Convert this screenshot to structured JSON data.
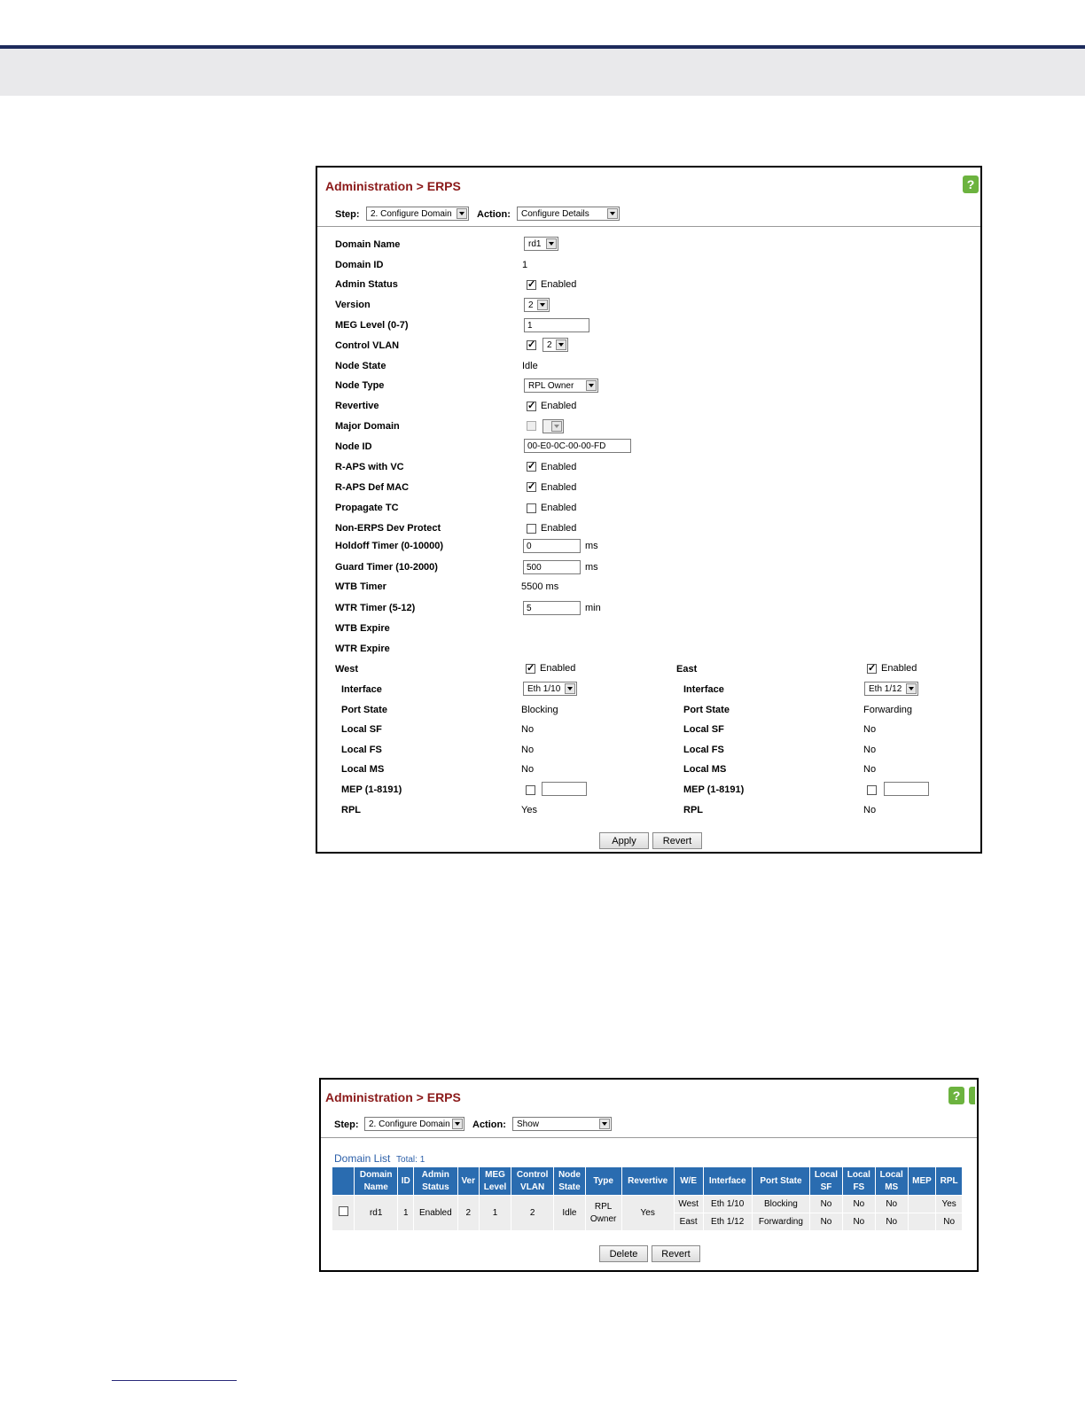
{
  "panel1": {
    "title": "Administration > ERPS",
    "step_label": "Step:",
    "step_value": "2. Configure Domain",
    "action_label": "Action:",
    "action_value": "Configure Details",
    "fields": {
      "domain_name": {
        "label": "Domain Name",
        "value": "rd1"
      },
      "domain_id": {
        "label": "Domain ID",
        "value": "1"
      },
      "admin_status": {
        "label": "Admin Status",
        "value": "Enabled"
      },
      "version": {
        "label": "Version",
        "value": "2"
      },
      "meg_level": {
        "label": "MEG Level (0-7)",
        "value": "1"
      },
      "control_vlan": {
        "label": "Control VLAN",
        "value": "2"
      },
      "node_state": {
        "label": "Node State",
        "value": "Idle"
      },
      "node_type": {
        "label": "Node Type",
        "value": "RPL Owner"
      },
      "revertive": {
        "label": "Revertive",
        "value": "Enabled"
      },
      "major_domain": {
        "label": "Major Domain",
        "value": ""
      },
      "node_id": {
        "label": "Node ID",
        "value": "00-E0-0C-00-00-FD"
      },
      "raps_vc": {
        "label": "R-APS with VC",
        "value": "Enabled"
      },
      "raps_def_mac": {
        "label": "R-APS Def MAC",
        "value": "Enabled"
      },
      "propagate_tc": {
        "label": "Propagate TC",
        "value": "Enabled"
      },
      "non_erps": {
        "label": "Non-ERPS Dev Protect",
        "value": "Enabled"
      },
      "holdoff": {
        "label": "Holdoff Timer (0-10000)",
        "value": "0",
        "unit": "ms"
      },
      "guard": {
        "label": "Guard Timer (10-2000)",
        "value": "500",
        "unit": "ms"
      },
      "wtb_timer": {
        "label": "WTB Timer",
        "value": "5500 ms"
      },
      "wtr_timer": {
        "label": "WTR Timer (5-12)",
        "value": "5",
        "unit": "min"
      },
      "wtb_expire": {
        "label": "WTB Expire"
      },
      "wtr_expire": {
        "label": "WTR Expire"
      }
    },
    "west": {
      "label": "West",
      "enabled": "Enabled",
      "interface_label": "Interface",
      "interface": "Eth 1/10",
      "port_state_label": "Port State",
      "port_state": "Blocking",
      "local_sf_label": "Local SF",
      "local_sf": "No",
      "local_fs_label": "Local FS",
      "local_fs": "No",
      "local_ms_label": "Local MS",
      "local_ms": "No",
      "mep_label": "MEP (1-8191)",
      "rpl_label": "RPL",
      "rpl": "Yes"
    },
    "east": {
      "label": "East",
      "enabled": "Enabled",
      "interface_label": "Interface",
      "interface": "Eth 1/12",
      "port_state_label": "Port State",
      "port_state": "Forwarding",
      "local_sf_label": "Local SF",
      "local_sf": "No",
      "local_fs_label": "Local FS",
      "local_fs": "No",
      "local_ms_label": "Local MS",
      "local_ms": "No",
      "mep_label": "MEP (1-8191)",
      "rpl_label": "RPL",
      "rpl": "No"
    },
    "apply": "Apply",
    "revert": "Revert"
  },
  "panel2": {
    "title": "Administration > ERPS",
    "step_label": "Step:",
    "step_value": "2. Configure Domain",
    "action_label": "Action:",
    "action_value": "Show",
    "list_title": "Domain List",
    "total": "Total: 1",
    "headers": {
      "domain_name": [
        "Domain",
        "Name"
      ],
      "id": "ID",
      "admin_status": [
        "Admin",
        "Status"
      ],
      "ver": "Ver",
      "meg_level": [
        "MEG",
        "Level"
      ],
      "control_vlan": [
        "Control",
        "VLAN"
      ],
      "node_state": [
        "Node",
        "State"
      ],
      "type": "Type",
      "revertive": "Revertive",
      "we": "W/E",
      "interface": "Interface",
      "port_state": "Port State",
      "local_sf": [
        "Local",
        "SF"
      ],
      "local_fs": [
        "Local",
        "FS"
      ],
      "local_ms": [
        "Local",
        "MS"
      ],
      "mep": "MEP",
      "rpl": "RPL"
    },
    "row": {
      "domain_name": "rd1",
      "id": "1",
      "admin_status": "Enabled",
      "ver": "2",
      "meg_level": "1",
      "control_vlan": "2",
      "node_state": "Idle",
      "type": [
        "RPL",
        "Owner"
      ],
      "revertive": "Yes",
      "west": {
        "we": "West",
        "interface": "Eth 1/10",
        "port_state": "Blocking",
        "local_sf": "No",
        "local_fs": "No",
        "local_ms": "No",
        "mep": "",
        "rpl": "Yes"
      },
      "east": {
        "we": "East",
        "interface": "Eth 1/12",
        "port_state": "Forwarding",
        "local_sf": "No",
        "local_fs": "No",
        "local_ms": "No",
        "mep": "",
        "rpl": "No"
      }
    },
    "delete": "Delete",
    "revert": "Revert"
  },
  "help_icon": "?"
}
